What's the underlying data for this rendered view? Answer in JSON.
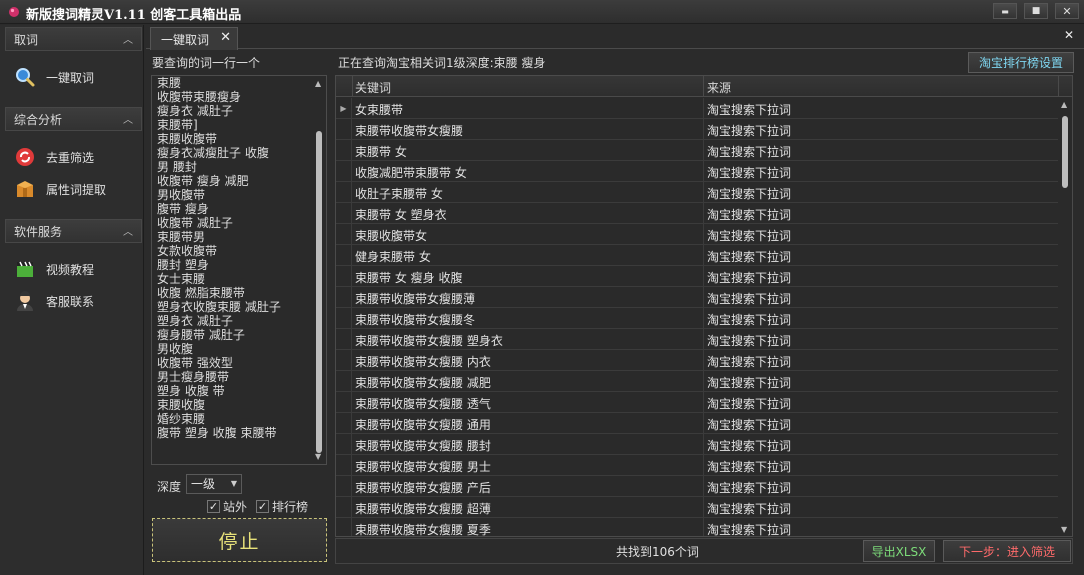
{
  "window": {
    "title": "新版搜词精灵V1.11  创客工具箱出品",
    "minimize_label": "▬",
    "maximize_label": "■",
    "close_label": "✕"
  },
  "sidebar": {
    "groups": [
      {
        "label": "取词",
        "items": [
          {
            "label": "一键取词",
            "icon": "magnifier-icon"
          }
        ]
      },
      {
        "label": "综合分析",
        "items": [
          {
            "label": "去重筛选",
            "icon": "dedupe-icon"
          },
          {
            "label": "属性词提取",
            "icon": "box-icon"
          }
        ]
      },
      {
        "label": "软件服务",
        "items": [
          {
            "label": "视频教程",
            "icon": "clapperboard-icon"
          },
          {
            "label": "客服联系",
            "icon": "support-agent-icon"
          }
        ]
      }
    ]
  },
  "tab": {
    "label": "一键取词",
    "close": "✕"
  },
  "panel_close": "✕",
  "left_panel": {
    "label": "要查询的词一行一个",
    "words": [
      "束腰",
      "收腹带束腰瘦身",
      "瘦身衣 减肚子",
      "束腰带]",
      "束腰收腹带",
      "瘦身衣减瘦肚子 收腹",
      "男 腰封",
      "收腹带 瘦身 减肥",
      "男收腹带",
      "腹带 瘦身",
      "收腹带 减肚子",
      "束腰带男",
      "女款收腹带",
      "腰封 塑身",
      "女士束腰",
      "收腹 燃脂束腰带",
      "塑身衣收腹束腰 减肚子",
      "塑身衣 减肚子",
      "瘦身腰带 减肚子",
      "男收腹",
      "收腹带 强效型",
      "男士瘦身腰带",
      "塑身 收腹 带",
      "束腰收腹",
      "婚纱束腰",
      "腹带 塑身 收腹 束腰带"
    ],
    "depth_label": "深度",
    "depth_value": "一级",
    "checkbox_site": "站外",
    "checkbox_rank": "排行榜",
    "site_checked": true,
    "rank_checked": true,
    "stop_label": "停止"
  },
  "main": {
    "status": "正在查询淘宝相关词1级深度:束腰 瘦身",
    "rank_settings_label": "淘宝排行榜设置",
    "columns": [
      "关键词",
      "来源"
    ],
    "rows": [
      [
        "女束腰带",
        "淘宝搜索下拉词"
      ],
      [
        "束腰带收腹带女瘦腰",
        "淘宝搜索下拉词"
      ],
      [
        "束腰带 女",
        "淘宝搜索下拉词"
      ],
      [
        "收腹减肥带束腰带 女",
        "淘宝搜索下拉词"
      ],
      [
        "收肚子束腰带 女",
        "淘宝搜索下拉词"
      ],
      [
        "束腰带 女 塑身衣",
        "淘宝搜索下拉词"
      ],
      [
        "束腰收腹带女",
        "淘宝搜索下拉词"
      ],
      [
        "健身束腰带 女",
        "淘宝搜索下拉词"
      ],
      [
        "束腰带 女 瘦身 收腹",
        "淘宝搜索下拉词"
      ],
      [
        "束腰带收腹带女瘦腰薄",
        "淘宝搜索下拉词"
      ],
      [
        "束腰带收腹带女瘦腰冬",
        "淘宝搜索下拉词"
      ],
      [
        "束腰带收腹带女瘦腰 塑身衣",
        "淘宝搜索下拉词"
      ],
      [
        "束腰带收腹带女瘦腰 内衣",
        "淘宝搜索下拉词"
      ],
      [
        "束腰带收腹带女瘦腰 减肥",
        "淘宝搜索下拉词"
      ],
      [
        "束腰带收腹带女瘦腰 透气",
        "淘宝搜索下拉词"
      ],
      [
        "束腰带收腹带女瘦腰 通用",
        "淘宝搜索下拉词"
      ],
      [
        "束腰带收腹带女瘦腰 腰封",
        "淘宝搜索下拉词"
      ],
      [
        "束腰带收腹带女瘦腰 男士",
        "淘宝搜索下拉词"
      ],
      [
        "束腰带收腹带女瘦腰 产后",
        "淘宝搜索下拉词"
      ],
      [
        "束腰带收腹带女瘦腰 超薄",
        "淘宝搜索下拉词"
      ],
      [
        "束腰带收腹带女瘦腰 夏季",
        "淘宝搜索下拉词"
      ]
    ],
    "count_text": "共找到106个词",
    "export_label": "导出XLSX",
    "next_label": "下一步：进入筛选"
  },
  "colors": {
    "stop_text": "#e8e27a",
    "rank_btn_text": "#7fd6f0",
    "export_text": "#7ddc7a",
    "next_text": "#ff6b6b"
  }
}
